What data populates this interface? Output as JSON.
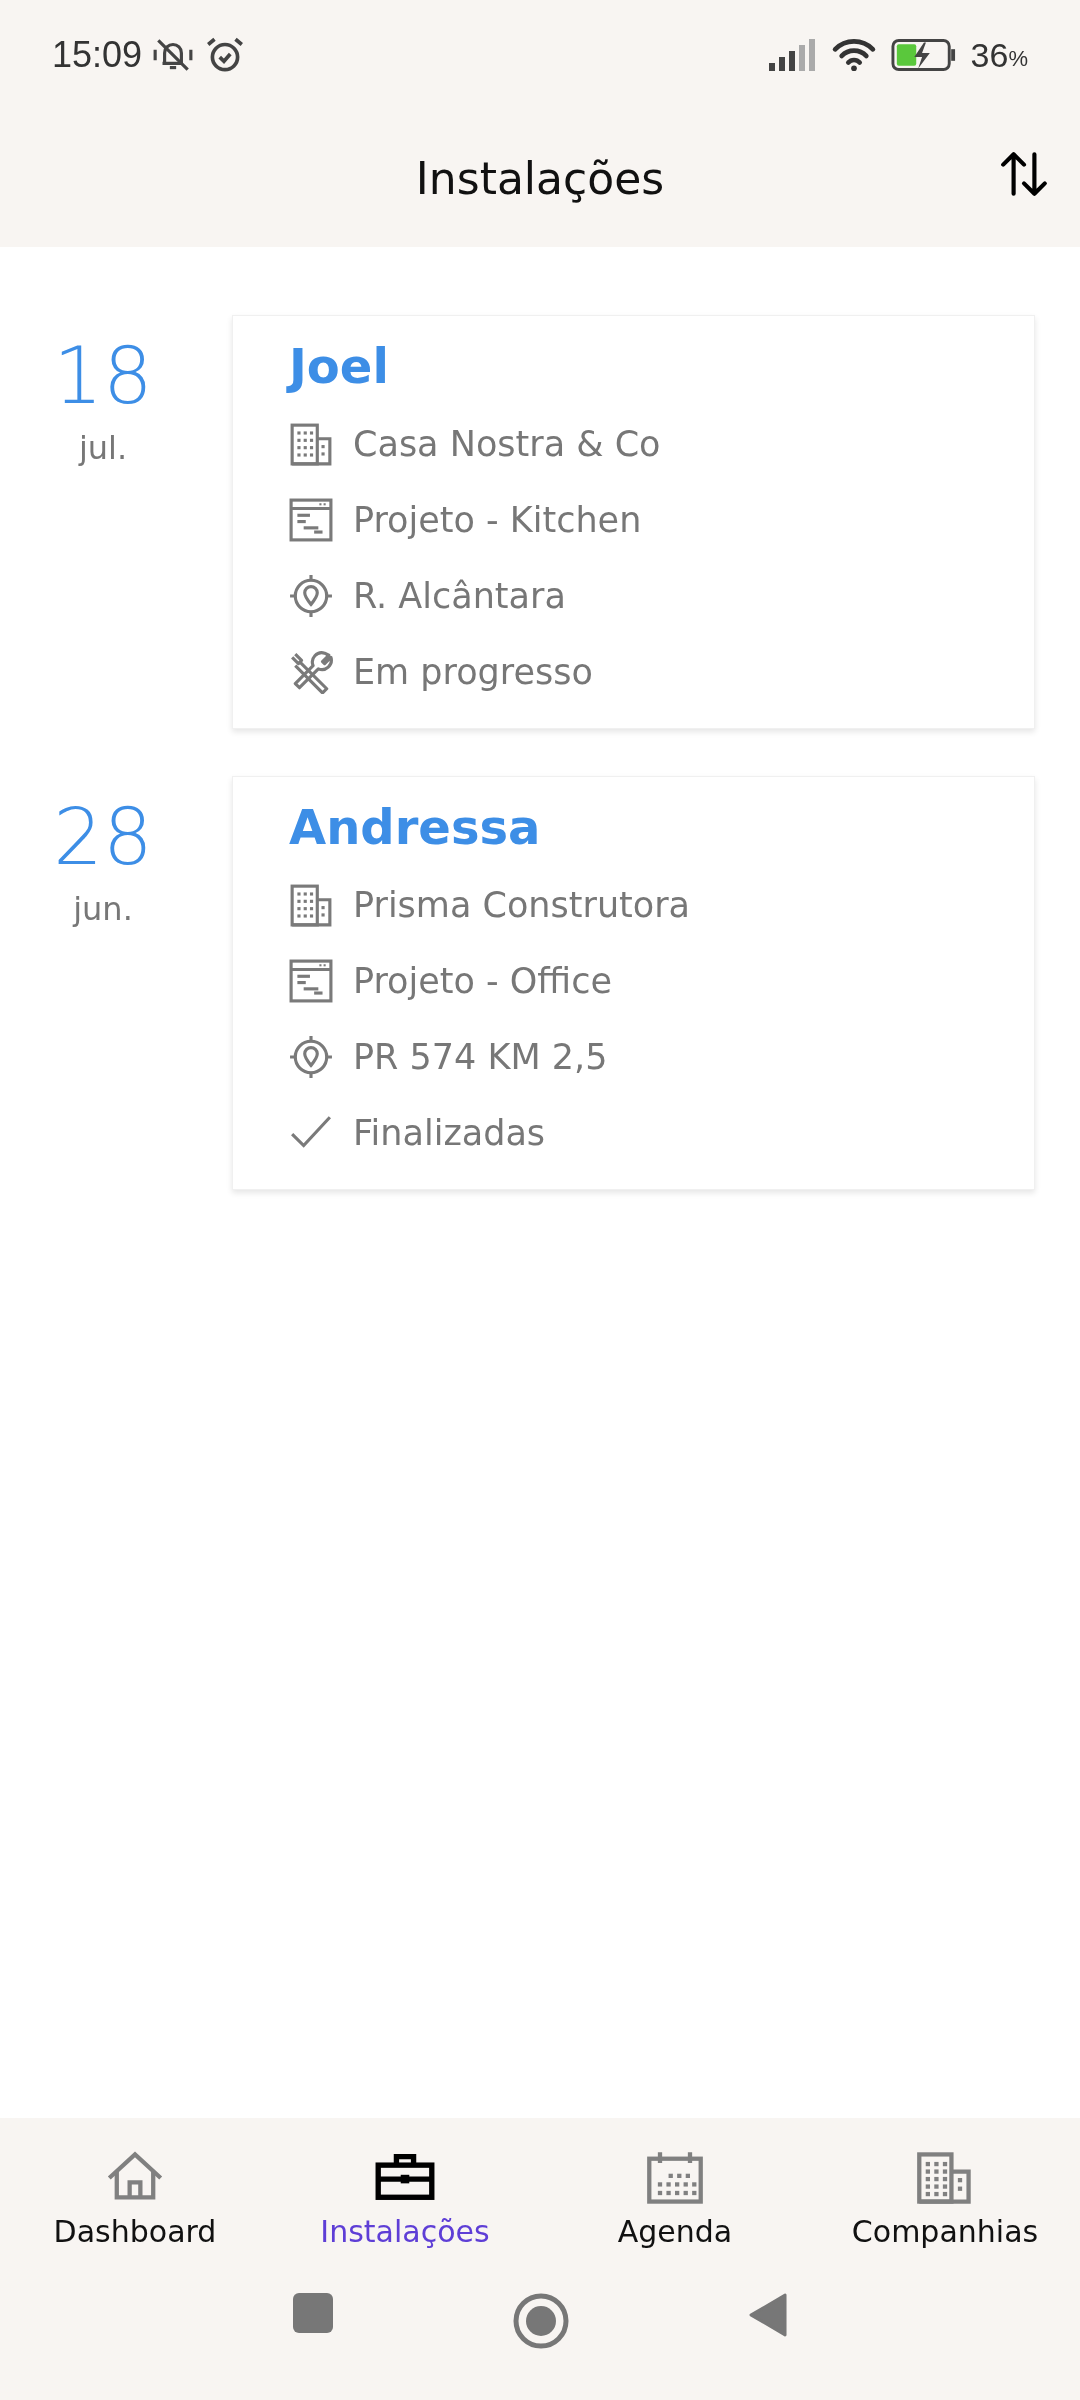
{
  "status_bar": {
    "time": "15:09",
    "battery": "36",
    "battery_unit": "%"
  },
  "header": {
    "title": "Instalações"
  },
  "installations": [
    {
      "day": "18",
      "month": "jul.",
      "name": "Joel",
      "details": [
        {
          "kind": "company",
          "text": "Casa Nostra & Co"
        },
        {
          "kind": "project",
          "text": "Projeto - Kitchen"
        },
        {
          "kind": "address",
          "text": "R. Alcântara"
        },
        {
          "kind": "in_progress",
          "text": "Em progresso"
        }
      ]
    },
    {
      "day": "28",
      "month": "jun.",
      "name": "Andressa",
      "details": [
        {
          "kind": "company",
          "text": "Prisma Construtora"
        },
        {
          "kind": "project",
          "text": "Projeto - Office"
        },
        {
          "kind": "address",
          "text": "PR 574 KM 2,5"
        },
        {
          "kind": "done",
          "text": "Finalizadas"
        }
      ]
    }
  ],
  "bottom_nav": [
    {
      "kind": "home",
      "label": "Dashboard",
      "selected": false
    },
    {
      "kind": "briefcase",
      "label": "Instalações",
      "selected": true
    },
    {
      "kind": "calendar",
      "label": "Agenda",
      "selected": false
    },
    {
      "kind": "buildings",
      "label": "Companhias",
      "selected": false
    }
  ]
}
